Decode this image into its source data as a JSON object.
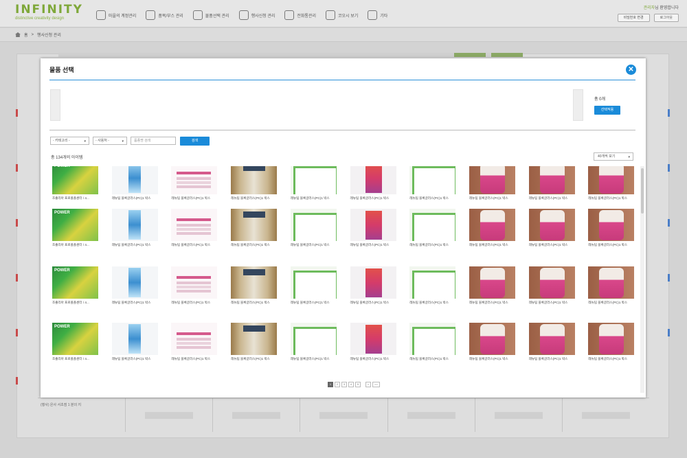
{
  "app": {
    "logo_name": "INFINITY",
    "logo_tagline": "distinctive creativity design",
    "nav": [
      "마을의 계정관리",
      "품목/부스 관리",
      "물품선택 관리",
      "행사신청 관리",
      "전화통관리",
      "코오시 보기",
      "기타"
    ],
    "welcome_user": "관리자",
    "welcome_suffix": "님 환영합니다",
    "btn_profile": "비밀번호 변경",
    "btn_logout": "로그아웃"
  },
  "breadcrumb": {
    "home": "홈",
    "current": "행사신청 관리"
  },
  "background_row": {
    "label": "(행사) 은사 서초점 1 분의 지"
  },
  "modal": {
    "title": "물품 선택",
    "close": "✕",
    "selected_count": "총 0개",
    "apply_button": "선택적용",
    "filters": {
      "category": "- 카테고리 -",
      "brand": "- 사용처 -",
      "search_placeholder": "품종명 검색",
      "search_button": "검색"
    },
    "total_items": "총 134개의 아이템",
    "view_option": "40개씩 보기",
    "grid": {
      "rows": [
        [
          {
            "label": "조졸리아 프로폴폴센터 / 4...",
            "img": "power"
          },
          {
            "label": "레뉴팀 블록글러스(PC)1 박스",
            "img": "blue"
          },
          {
            "label": "레뉴팀 블록글러스(PC)1 박스",
            "img": "pinktext"
          },
          {
            "label": "레뉴팀 블록글러스(PC)1 박스",
            "img": "brown"
          },
          {
            "label": "레뉴팀 블록글러스(PC)1 박스",
            "img": "green"
          },
          {
            "label": "레뉴팀 블록글러스(PC)1 박스",
            "img": "red"
          },
          {
            "label": "레뉴팀 블록글러스(PC)1 박스",
            "img": "green"
          },
          {
            "label": "레뉴팀 블록글러스(PC)1 박스",
            "img": "jar"
          },
          {
            "label": "레뉴팀 블록글러스(PC)1 박스",
            "img": "jar"
          },
          {
            "label": "레뉴팀 블록글러스(PC)1 박스",
            "img": "jar"
          }
        ],
        [
          {
            "label": "조졸리아 프로폴폴센터 / 4...",
            "img": "power"
          },
          {
            "label": "레뉴팀 블록글러스(PC)1 박스",
            "img": "blue"
          },
          {
            "label": "레뉴팀 블록글러스(PC)1 박스",
            "img": "pinktext"
          },
          {
            "label": "레뉴팀 블록글러스(PC)1 박스",
            "img": "brown"
          },
          {
            "label": "레뉴팀 블록글러스(PC)1 박스",
            "img": "green"
          },
          {
            "label": "레뉴팀 블록글러스(PC)1 박스",
            "img": "red"
          },
          {
            "label": "레뉴팀 블록글러스(PC)1 박스",
            "img": "green"
          },
          {
            "label": "레뉴팀 블록글러스(PC)1 박스",
            "img": "jar"
          },
          {
            "label": "레뉴팀 블록글러스(PC)1 박스",
            "img": "jar"
          },
          {
            "label": "레뉴팀 블록글러스(PC)1 박스",
            "img": "jar"
          }
        ],
        [
          {
            "label": "조졸리아 프로폴폴센터 / 4...",
            "img": "power"
          },
          {
            "label": "레뉴팀 블록글러스(PC)1 박스",
            "img": "blue"
          },
          {
            "label": "레뉴팀 블록글러스(PC)1 박스",
            "img": "pinktext"
          },
          {
            "label": "레뉴팀 블록글러스(PC)1 박스",
            "img": "brown"
          },
          {
            "label": "레뉴팀 블록글러스(PC)1 박스",
            "img": "green"
          },
          {
            "label": "레뉴팀 블록글러스(PC)1 박스",
            "img": "red"
          },
          {
            "label": "레뉴팀 블록글러스(PC)1 박스",
            "img": "green"
          },
          {
            "label": "레뉴팀 블록글러스(PC)1 박스",
            "img": "jar"
          },
          {
            "label": "레뉴팀 블록글러스(PC)1 박스",
            "img": "jar"
          },
          {
            "label": "레뉴팀 블록글러스(PC)1 박스",
            "img": "jar"
          }
        ],
        [
          {
            "label": "조졸리아 프로폴폴센터 / 4...",
            "img": "power"
          },
          {
            "label": "레뉴팀 블록글러스(PC)1 박스",
            "img": "blue"
          },
          {
            "label": "레뉴팀 블록글러스(PC)1 박스",
            "img": "pinktext"
          },
          {
            "label": "레뉴팀 블록글러스(PC)1 박스",
            "img": "brown"
          },
          {
            "label": "레뉴팀 블록글러스(PC)1 박스",
            "img": "green"
          },
          {
            "label": "레뉴팀 블록글러스(PC)1 박스",
            "img": "red"
          },
          {
            "label": "레뉴팀 블록글러스(PC)1 박스",
            "img": "green"
          },
          {
            "label": "레뉴팀 블록글러스(PC)1 박스",
            "img": "jar"
          },
          {
            "label": "레뉴팀 블록글러스(PC)1 박스",
            "img": "jar"
          },
          {
            "label": "레뉴팀 블록글러스(PC)1 박스",
            "img": "jar"
          }
        ]
      ]
    },
    "pagination": {
      "pages": [
        "1",
        "2",
        "3",
        "4",
        "5"
      ],
      "next": ">",
      "last": ">>",
      "active": "1"
    }
  },
  "colors": {
    "accent": "#1a8bd9",
    "brand_green": "#7fa83a",
    "overlay": "#d3d3d3"
  }
}
